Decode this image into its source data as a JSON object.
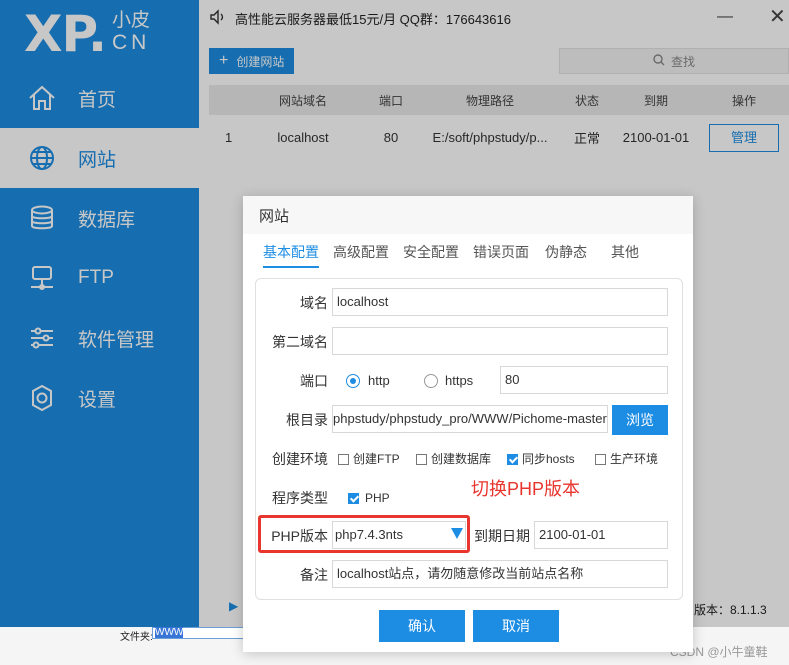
{
  "logo": {
    "xp": "XP.",
    "cn1": "小皮",
    "cn2": "CN"
  },
  "sidebar": {
    "items": [
      {
        "label": "首页",
        "icon": "home-icon"
      },
      {
        "label": "网站",
        "icon": "globe-icon",
        "active": true
      },
      {
        "label": "数据库",
        "icon": "database-icon"
      },
      {
        "label": "FTP",
        "icon": "server-icon"
      },
      {
        "label": "软件管理",
        "icon": "sliders-icon"
      },
      {
        "label": "设置",
        "icon": "gear-icon"
      }
    ]
  },
  "topbar": {
    "notice": "高性能云服务器最低15元/月   QQ群：176643616"
  },
  "toolbar": {
    "create_label": "创建网站",
    "search_placeholder": "查找"
  },
  "table": {
    "headers": [
      "网站域名",
      "端口",
      "物理路径",
      "状态",
      "到期",
      "操作"
    ],
    "rows": [
      {
        "index": "1",
        "domain": "localhost",
        "port": "80",
        "path": "E:/soft/phpstudy/p...",
        "status": "正常",
        "expire": "2100-01-01",
        "action": "管理"
      }
    ]
  },
  "bottombar": {
    "version": "版本：8.1.1.3"
  },
  "under": {
    "label": "文件夹:",
    "value": "WWW"
  },
  "watermark": "CSDN @小牛童鞋",
  "dialog": {
    "title": "网站",
    "tabs": [
      "基本配置",
      "高级配置",
      "安全配置",
      "错误页面",
      "伪静态",
      "其他"
    ],
    "form": {
      "domain_label": "域名",
      "domain_value": "localhost",
      "second_domain_label": "第二域名",
      "second_domain_value": "",
      "port_label": "端口",
      "http_label": "http",
      "https_label": "https",
      "port_value": "80",
      "root_label": "根目录",
      "root_value": "phpstudy/phpstudy_pro/WWW/Pichome-master",
      "browse_label": "浏览",
      "env_label": "创建环境",
      "env_options": [
        {
          "label": "创建FTP",
          "checked": false
        },
        {
          "label": "创建数据库",
          "checked": false
        },
        {
          "label": "同步hosts",
          "checked": true
        },
        {
          "label": "生产环境",
          "checked": false
        }
      ],
      "prog_label": "程序类型",
      "prog_option": "PHP",
      "hint": "切换PHP版本",
      "php_label": "PHP版本",
      "php_value": "php7.4.3nts",
      "expire_label": "到期日期",
      "expire_value": "2100-01-01",
      "note_label": "备注",
      "note_value": "localhost站点，请勿随意修改当前站点名称"
    },
    "ok_label": "确认",
    "cancel_label": "取消"
  },
  "colors": {
    "primary": "#1d8de3",
    "highlight": "#e8352e"
  }
}
